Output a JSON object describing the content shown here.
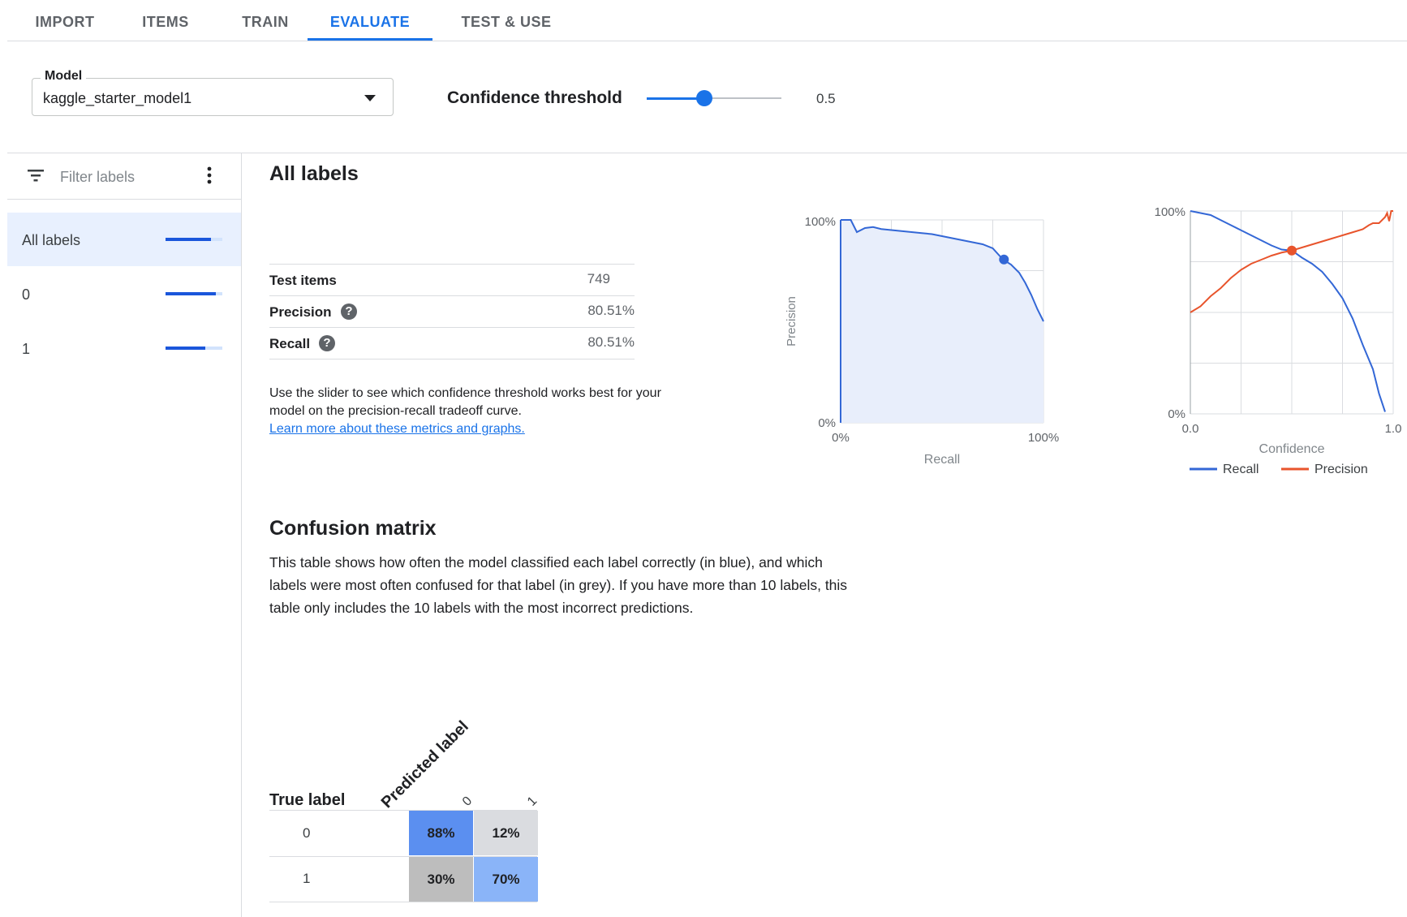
{
  "tabs": [
    {
      "label": "IMPORT"
    },
    {
      "label": "ITEMS"
    },
    {
      "label": "TRAIN"
    },
    {
      "label": "EVALUATE"
    },
    {
      "label": "TEST & USE"
    }
  ],
  "active_tab": "EVALUATE",
  "model": {
    "label": "Model",
    "value": "kaggle_starter_model1"
  },
  "confidence": {
    "label": "Confidence threshold",
    "value": "0.5",
    "fraction": 0.5
  },
  "sidebar": {
    "filter_placeholder": "Filter labels",
    "items": [
      {
        "label": "All labels",
        "score": 0.8051
      },
      {
        "label": "0",
        "score": 0.88
      },
      {
        "label": "1",
        "score": 0.7
      }
    ]
  },
  "main": {
    "title": "All labels",
    "metrics": [
      {
        "name": "Test items",
        "value": "749"
      },
      {
        "name": "Precision",
        "value": "80.51%"
      },
      {
        "name": "Recall",
        "value": "80.51%"
      }
    ],
    "help_glyph": "?",
    "description": "Use the slider to see which confidence threshold works best for your model on the precision-recall tradeoff curve.",
    "link_text": "Learn more about these metrics and graphs."
  },
  "colors": {
    "accent": "#1a73e8",
    "recall_line": "#3367d6",
    "precision_line": "#e8542c",
    "cm_correct_high": "#5b8ff0",
    "cm_correct_low": "#8ab4f8",
    "cm_incorrect_low": "#dadce0",
    "cm_incorrect_high": "#bdbdbd"
  },
  "chart_data": [
    {
      "type": "area",
      "xlabel": "Recall",
      "ylabel": "Precision",
      "x_ticks": [
        "0%",
        "100%"
      ],
      "y_ticks": [
        "0%",
        "100%"
      ],
      "xlim": [
        0,
        1
      ],
      "ylim": [
        0,
        1
      ],
      "grid": true,
      "points": [
        [
          0,
          1.0
        ],
        [
          0.05,
          1.0
        ],
        [
          0.08,
          0.94
        ],
        [
          0.12,
          0.96
        ],
        [
          0.16,
          0.965
        ],
        [
          0.2,
          0.955
        ],
        [
          0.25,
          0.95
        ],
        [
          0.3,
          0.945
        ],
        [
          0.35,
          0.94
        ],
        [
          0.4,
          0.935
        ],
        [
          0.45,
          0.93
        ],
        [
          0.5,
          0.92
        ],
        [
          0.55,
          0.91
        ],
        [
          0.6,
          0.9
        ],
        [
          0.65,
          0.89
        ],
        [
          0.7,
          0.88
        ],
        [
          0.75,
          0.86
        ],
        [
          0.8,
          0.805
        ],
        [
          0.84,
          0.78
        ],
        [
          0.88,
          0.74
        ],
        [
          0.91,
          0.69
        ],
        [
          0.94,
          0.63
        ],
        [
          0.97,
          0.56
        ],
        [
          1.0,
          0.5
        ]
      ],
      "marker": {
        "x": 0.8051,
        "y": 0.8051
      }
    },
    {
      "type": "line",
      "xlabel": "Confidence",
      "x_ticks": [
        "0.0",
        "1.0"
      ],
      "y_ticks": [
        "0%",
        "100%"
      ],
      "xlim": [
        0,
        1
      ],
      "ylim": [
        0,
        1
      ],
      "grid": true,
      "legend_position": "bottom",
      "series": [
        {
          "name": "Recall",
          "points": [
            [
              0,
              1.0
            ],
            [
              0.05,
              0.99
            ],
            [
              0.1,
              0.98
            ],
            [
              0.15,
              0.955
            ],
            [
              0.2,
              0.93
            ],
            [
              0.25,
              0.905
            ],
            [
              0.3,
              0.88
            ],
            [
              0.35,
              0.855
            ],
            [
              0.4,
              0.83
            ],
            [
              0.45,
              0.81
            ],
            [
              0.5,
              0.8051
            ],
            [
              0.55,
              0.77
            ],
            [
              0.6,
              0.74
            ],
            [
              0.65,
              0.7
            ],
            [
              0.7,
              0.64
            ],
            [
              0.75,
              0.57
            ],
            [
              0.8,
              0.47
            ],
            [
              0.85,
              0.34
            ],
            [
              0.9,
              0.22
            ],
            [
              0.93,
              0.1
            ],
            [
              0.96,
              0.01
            ]
          ]
        },
        {
          "name": "Precision",
          "points": [
            [
              0,
              0.5
            ],
            [
              0.05,
              0.53
            ],
            [
              0.1,
              0.58
            ],
            [
              0.15,
              0.62
            ],
            [
              0.2,
              0.67
            ],
            [
              0.25,
              0.71
            ],
            [
              0.3,
              0.74
            ],
            [
              0.35,
              0.76
            ],
            [
              0.4,
              0.78
            ],
            [
              0.45,
              0.795
            ],
            [
              0.5,
              0.8051
            ],
            [
              0.55,
              0.82
            ],
            [
              0.6,
              0.835
            ],
            [
              0.65,
              0.85
            ],
            [
              0.7,
              0.865
            ],
            [
              0.75,
              0.88
            ],
            [
              0.8,
              0.895
            ],
            [
              0.85,
              0.91
            ],
            [
              0.88,
              0.93
            ],
            [
              0.9,
              0.94
            ],
            [
              0.93,
              0.94
            ],
            [
              0.96,
              0.97
            ],
            [
              0.97,
              0.99
            ],
            [
              0.98,
              0.95
            ],
            [
              0.99,
              1.0
            ],
            [
              1.0,
              1.0
            ]
          ]
        }
      ],
      "marker": {
        "x": 0.5,
        "y": 0.8051
      }
    }
  ],
  "confusion_matrix": {
    "title": "Confusion matrix",
    "description": "This table shows how often the model classified each label correctly (in blue), and which labels were most often confused for that label (in grey). If you have more than 10 labels, this table only includes the 10 labels with the most incorrect predictions.",
    "true_label": "True label",
    "predicted_label": "Predicted label",
    "columns": [
      "0",
      "1"
    ],
    "rows": [
      {
        "label": "0",
        "cells": [
          "88%",
          "12%"
        ]
      },
      {
        "label": "1",
        "cells": [
          "30%",
          "70%"
        ]
      }
    ]
  }
}
